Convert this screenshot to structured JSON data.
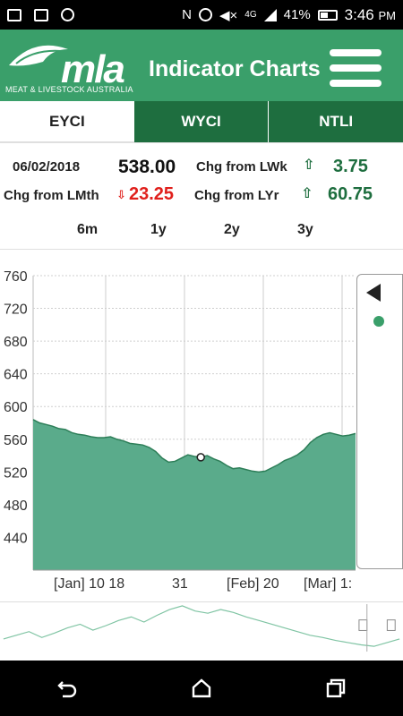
{
  "status_bar": {
    "battery": "41%",
    "time": "3:46",
    "ampm": "PM"
  },
  "header": {
    "logo_text": "mla",
    "logo_subtext": "MEAT & LIVESTOCK AUSTRALIA",
    "title": "Indicator Charts"
  },
  "tabs": [
    {
      "label": "EYCI",
      "active": true
    },
    {
      "label": "WYCI",
      "active": false
    },
    {
      "label": "NTLI",
      "active": false
    }
  ],
  "info": {
    "date": "06/02/2018",
    "price": "538.00",
    "chg_lwk_label": "Chg from LWk",
    "chg_lwk_value": "3.75",
    "chg_lmth_label": "Chg from LMth",
    "chg_lmth_value": "23.25",
    "chg_lyr_label": "Chg from LYr",
    "chg_lyr_value": "60.75"
  },
  "periods": [
    "6m",
    "1y",
    "2y",
    "3y"
  ],
  "colors": {
    "brand_green": "#3a9f6a",
    "dark_green": "#1e6e3f",
    "area_fill": "#5aab8b",
    "down_red": "#e0201c"
  },
  "chart_data": {
    "type": "area",
    "ylim": [
      400,
      760
    ],
    "y_ticks": [
      "760",
      "720",
      "680",
      "640",
      "600",
      "560",
      "520",
      "480",
      "440"
    ],
    "x_tick_labels": [
      "[Jan] 10 18",
      "31",
      "[Feb] 20",
      "[Mar] 1:"
    ],
    "values": [
      584,
      580,
      578,
      576,
      573,
      572,
      568,
      566,
      565,
      563,
      562,
      562,
      563,
      560,
      558,
      555,
      554,
      553,
      550,
      545,
      537,
      532,
      533,
      537,
      541,
      539,
      538,
      540,
      536,
      533,
      528,
      524,
      525,
      523,
      521,
      520,
      521,
      525,
      529,
      534,
      537,
      541,
      547,
      556,
      562,
      566,
      568,
      566,
      564,
      565,
      567
    ],
    "highlight_value": 538.0,
    "highlight_index": 26,
    "navigator_series": [
      560,
      565,
      570,
      562,
      568,
      575,
      580,
      572,
      578,
      585,
      590,
      583,
      592,
      600,
      605,
      598,
      595,
      600,
      596,
      590,
      585,
      580,
      575,
      570,
      565,
      562,
      558,
      555,
      552,
      550,
      555,
      560
    ]
  },
  "icons": {
    "back": "back-icon",
    "home": "home-icon",
    "recents": "recents-icon",
    "menu": "hamburger-menu-icon",
    "legend_toggle": "triangle-left-icon"
  }
}
